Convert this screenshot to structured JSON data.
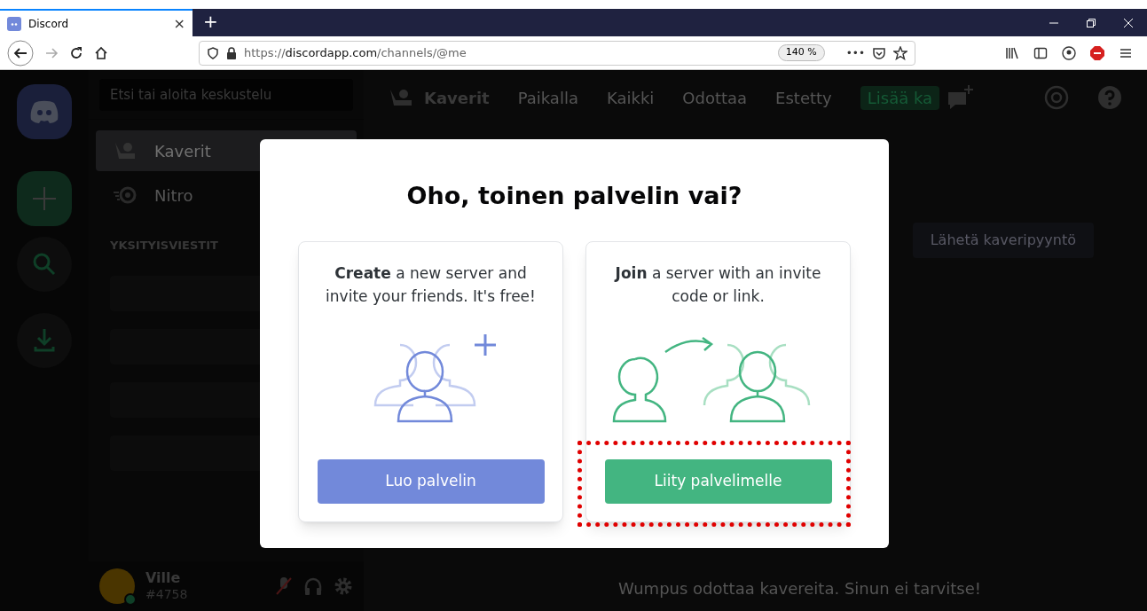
{
  "browser": {
    "tab": {
      "title": "Discord",
      "close": "×"
    },
    "new_tab": "+",
    "url": {
      "scheme": "https://",
      "domain": "discordapp.com",
      "path": "/channels/@me"
    },
    "zoom": "140 %",
    "more": "•••"
  },
  "discord": {
    "search": {
      "placeholder": "Etsi tai aloita keskustelu"
    },
    "nav": [
      {
        "kind": "friends",
        "label": "Kaverit",
        "selected": true
      },
      {
        "kind": "nitro",
        "label": "Nitro",
        "selected": false
      }
    ],
    "section_title": "YKSITYISVIESTIT",
    "user": {
      "name": "Ville",
      "tag": "#4758"
    },
    "header": {
      "title": "Kaverit",
      "tabs": [
        "Paikalla",
        "Kaikki",
        "Odottaa",
        "Estetty"
      ],
      "add_friend": "Lisää ka"
    },
    "add_friend_button": "Lähetä kaveripyyntö",
    "empty_text": "Wumpus odottaa kavereita. Sinun ei tarvitse!"
  },
  "modal": {
    "title": "Oho, toinen palvelin vai?",
    "cards": [
      {
        "kind": "create",
        "text": "**Create** a new server and invite your friends. It's free!",
        "button": "Luo palvelin",
        "highlighted": false
      },
      {
        "kind": "join",
        "text": "**Join** a server with an invite code or link.",
        "button": "Liity palvelimelle",
        "highlighted": true
      }
    ]
  }
}
